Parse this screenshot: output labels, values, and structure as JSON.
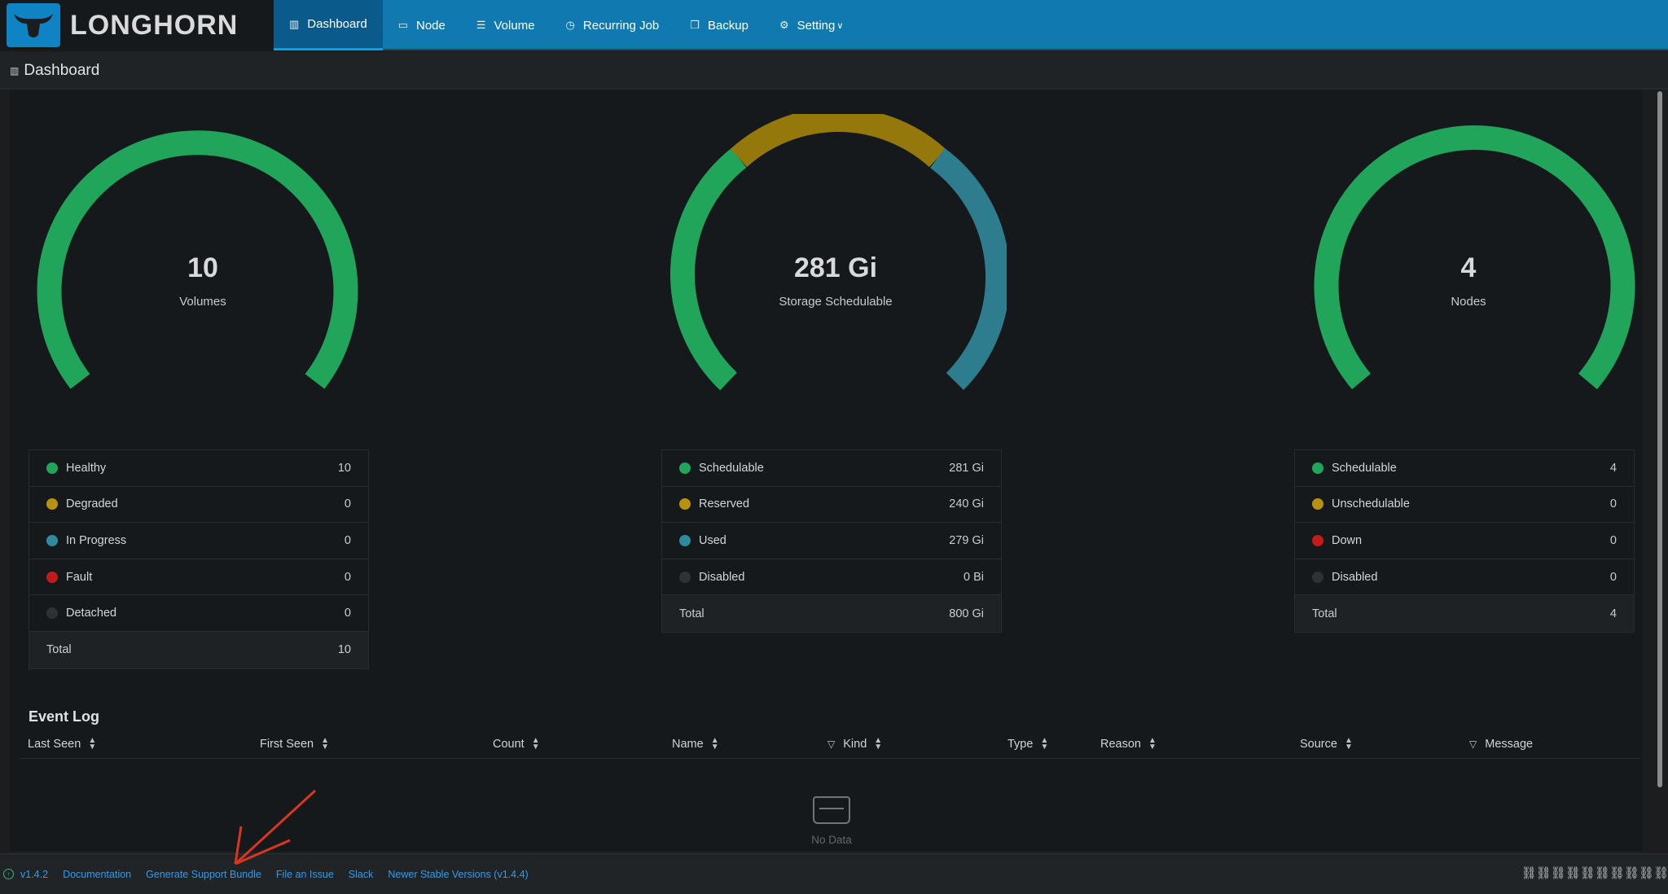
{
  "app": {
    "name": "LONGHORN"
  },
  "nav": [
    {
      "label": "Dashboard",
      "icon": "bar-chart-icon",
      "active": true
    },
    {
      "label": "Node",
      "icon": "monitor-icon"
    },
    {
      "label": "Volume",
      "icon": "database-icon"
    },
    {
      "label": "Recurring Job",
      "icon": "clock-icon"
    },
    {
      "label": "Backup",
      "icon": "copy-icon"
    },
    {
      "label": "Setting",
      "icon": "gear-icon"
    }
  ],
  "page": {
    "title": "Dashboard"
  },
  "gauges": [
    {
      "value": "10",
      "label": "Volumes"
    },
    {
      "value": "281 Gi",
      "label": "Storage Schedulable"
    },
    {
      "value": "4",
      "label": "Nodes"
    }
  ],
  "volumes_legend": {
    "rows": [
      {
        "name": "Healthy",
        "value": "10",
        "color": "#21a55a"
      },
      {
        "name": "Degraded",
        "value": "0",
        "color": "#b8920f"
      },
      {
        "name": "In Progress",
        "value": "0",
        "color": "#2e8b9e"
      },
      {
        "name": "Fault",
        "value": "0",
        "color": "#c51a1a"
      },
      {
        "name": "Detached",
        "value": "0",
        "color": "#2f3235"
      }
    ],
    "total_label": "Total",
    "total_value": "10"
  },
  "storage_legend": {
    "rows": [
      {
        "name": "Schedulable",
        "value": "281 Gi",
        "color": "#21a55a"
      },
      {
        "name": "Reserved",
        "value": "240 Gi",
        "color": "#b8920f"
      },
      {
        "name": "Used",
        "value": "279 Gi",
        "color": "#2e8b9e"
      },
      {
        "name": "Disabled",
        "value": "0 Bi",
        "color": "#2f3235"
      }
    ],
    "total_label": "Total",
    "total_value": "800 Gi"
  },
  "nodes_legend": {
    "rows": [
      {
        "name": "Schedulable",
        "value": "4",
        "color": "#21a55a"
      },
      {
        "name": "Unschedulable",
        "value": "0",
        "color": "#b8920f"
      },
      {
        "name": "Down",
        "value": "0",
        "color": "#c51a1a"
      },
      {
        "name": "Disabled",
        "value": "0",
        "color": "#2f3235"
      }
    ],
    "total_label": "Total",
    "total_value": "4"
  },
  "event_log": {
    "title": "Event Log",
    "columns": [
      "Last Seen",
      "First Seen",
      "Count",
      "Name",
      "Kind",
      "Type",
      "Reason",
      "Source",
      "Message"
    ],
    "empty_text": "No Data"
  },
  "footer": {
    "version": "v1.4.2",
    "links": [
      "Documentation",
      "Generate Support Bundle",
      "File an Issue",
      "Slack",
      "Newer Stable Versions (v1.4.4)"
    ]
  },
  "colors": {
    "green": "#21a55a",
    "gold": "#94780b",
    "teal": "#2e7d8e",
    "red": "#c51a1a",
    "accent": "#0f79b0"
  }
}
